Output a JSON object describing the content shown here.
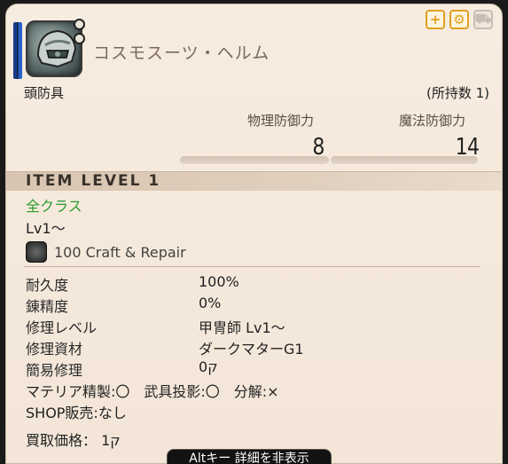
{
  "item": {
    "name": "コスモスーツ・ヘルム",
    "category": "頭防具",
    "owned": "(所持数 1)",
    "item_level": "ITEM LEVEL 1",
    "classes": "全クラス",
    "level": "Lv1～",
    "craft_repair": "100 Craft & Repair"
  },
  "stats": {
    "physical_label": "物理防御力",
    "physical_value": "8",
    "magic_label": "魔法防御力",
    "magic_value": "14"
  },
  "details": [
    {
      "label": "耐久度",
      "value": "100%"
    },
    {
      "label": "錬精度",
      "value": "0%"
    },
    {
      "label": "修理レベル",
      "value": "甲冑師 Lv1～"
    },
    {
      "label": "修理資材",
      "value": "ダークマターG1"
    },
    {
      "label": "簡易修理",
      "value": "0ק"
    }
  ],
  "flags": {
    "line1": "マテリア精製:〇　武具投影:〇　分解:×",
    "line2": "SHOP販売:なし"
  },
  "price": "買取価格：  1ק",
  "footer": "Altキー 詳細を非表示",
  "top_icons": [
    "plus-icon",
    "gear-plus-icon",
    "cart-icon"
  ],
  "colors": {
    "classes": "#2e9a2e",
    "panel": "#f3e6d8",
    "header_bar": "#173a8a"
  }
}
